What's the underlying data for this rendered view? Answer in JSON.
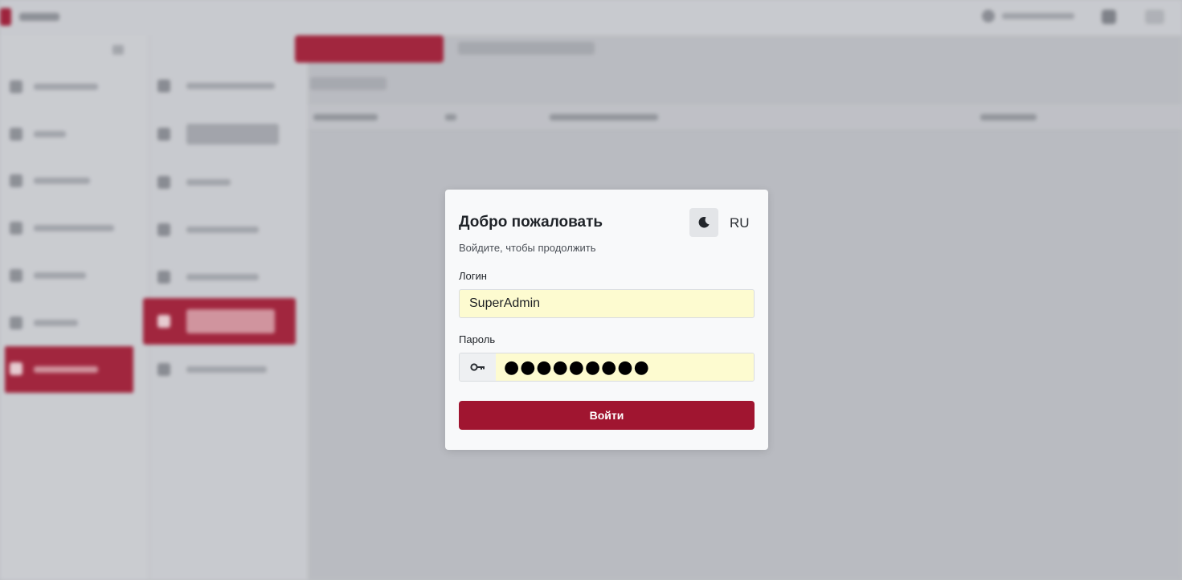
{
  "login": {
    "title": "Добро пожаловать",
    "subtitle": "Войдите, чтобы продолжить",
    "language": "RU",
    "theme_icon": "moon-icon",
    "login_label": "Логин",
    "login_value": "SuperAdmin",
    "password_label": "Пароль",
    "password_icon": "key-icon",
    "password_value": "●●●●●●●●●",
    "submit_label": "Войти"
  },
  "colors": {
    "accent": "#a01530",
    "autofill": "#fdfbd0"
  }
}
